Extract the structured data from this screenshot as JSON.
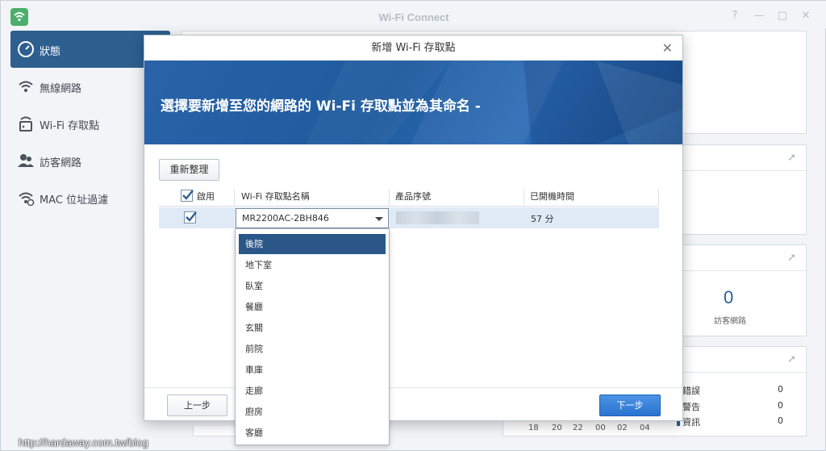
{
  "window": {
    "title": "Wi-Fi Connect",
    "help_icon": "?",
    "minimize_icon": "—",
    "maximize_icon": "□",
    "close_icon": "✕"
  },
  "sidebar": {
    "items": [
      {
        "label": "狀態",
        "icon": "gauge-icon",
        "active": true
      },
      {
        "label": "無線網路",
        "icon": "wifi-icon"
      },
      {
        "label": "Wi-Fi 存取點",
        "icon": "router-icon"
      },
      {
        "label": "訪客網路",
        "icon": "guest-users-icon"
      },
      {
        "label": "MAC 位址過濾",
        "icon": "wifi-filter-icon"
      }
    ]
  },
  "background": {
    "guest_count": "0",
    "guest_label": "訪客網路",
    "log_legend": [
      {
        "label": "錯誤",
        "value": "0",
        "color": "#c0392b"
      },
      {
        "label": "警告",
        "value": "0",
        "color": "#e69a2b"
      },
      {
        "label": "資訊",
        "value": "0",
        "color": "#2a5f96"
      }
    ],
    "time_ticks": [
      "18",
      "20",
      "22",
      "00",
      "02",
      "04"
    ]
  },
  "dialog": {
    "title": "新增 Wi-Fi 存取點",
    "heading": "選擇要新增至您的網路的 Wi-Fi 存取點並為其命名 -",
    "refresh_label": "重新整理",
    "columns": {
      "enable": "啟用",
      "name": "Wi-Fi 存取點名稱",
      "serial": "產品序號",
      "uptime": "已開機時間"
    },
    "row": {
      "enabled": true,
      "name": "MR2200AC-2BH846",
      "uptime": "57 分"
    },
    "dropdown_options": [
      "後院",
      "地下室",
      "臥室",
      "餐廳",
      "玄關",
      "前院",
      "車庫",
      "走廊",
      "廚房",
      "客廳"
    ],
    "selected_option": "後院",
    "back_label": "上一步",
    "next_label": "下一步"
  },
  "watermark": "http://hardaway.com.tw/blog"
}
